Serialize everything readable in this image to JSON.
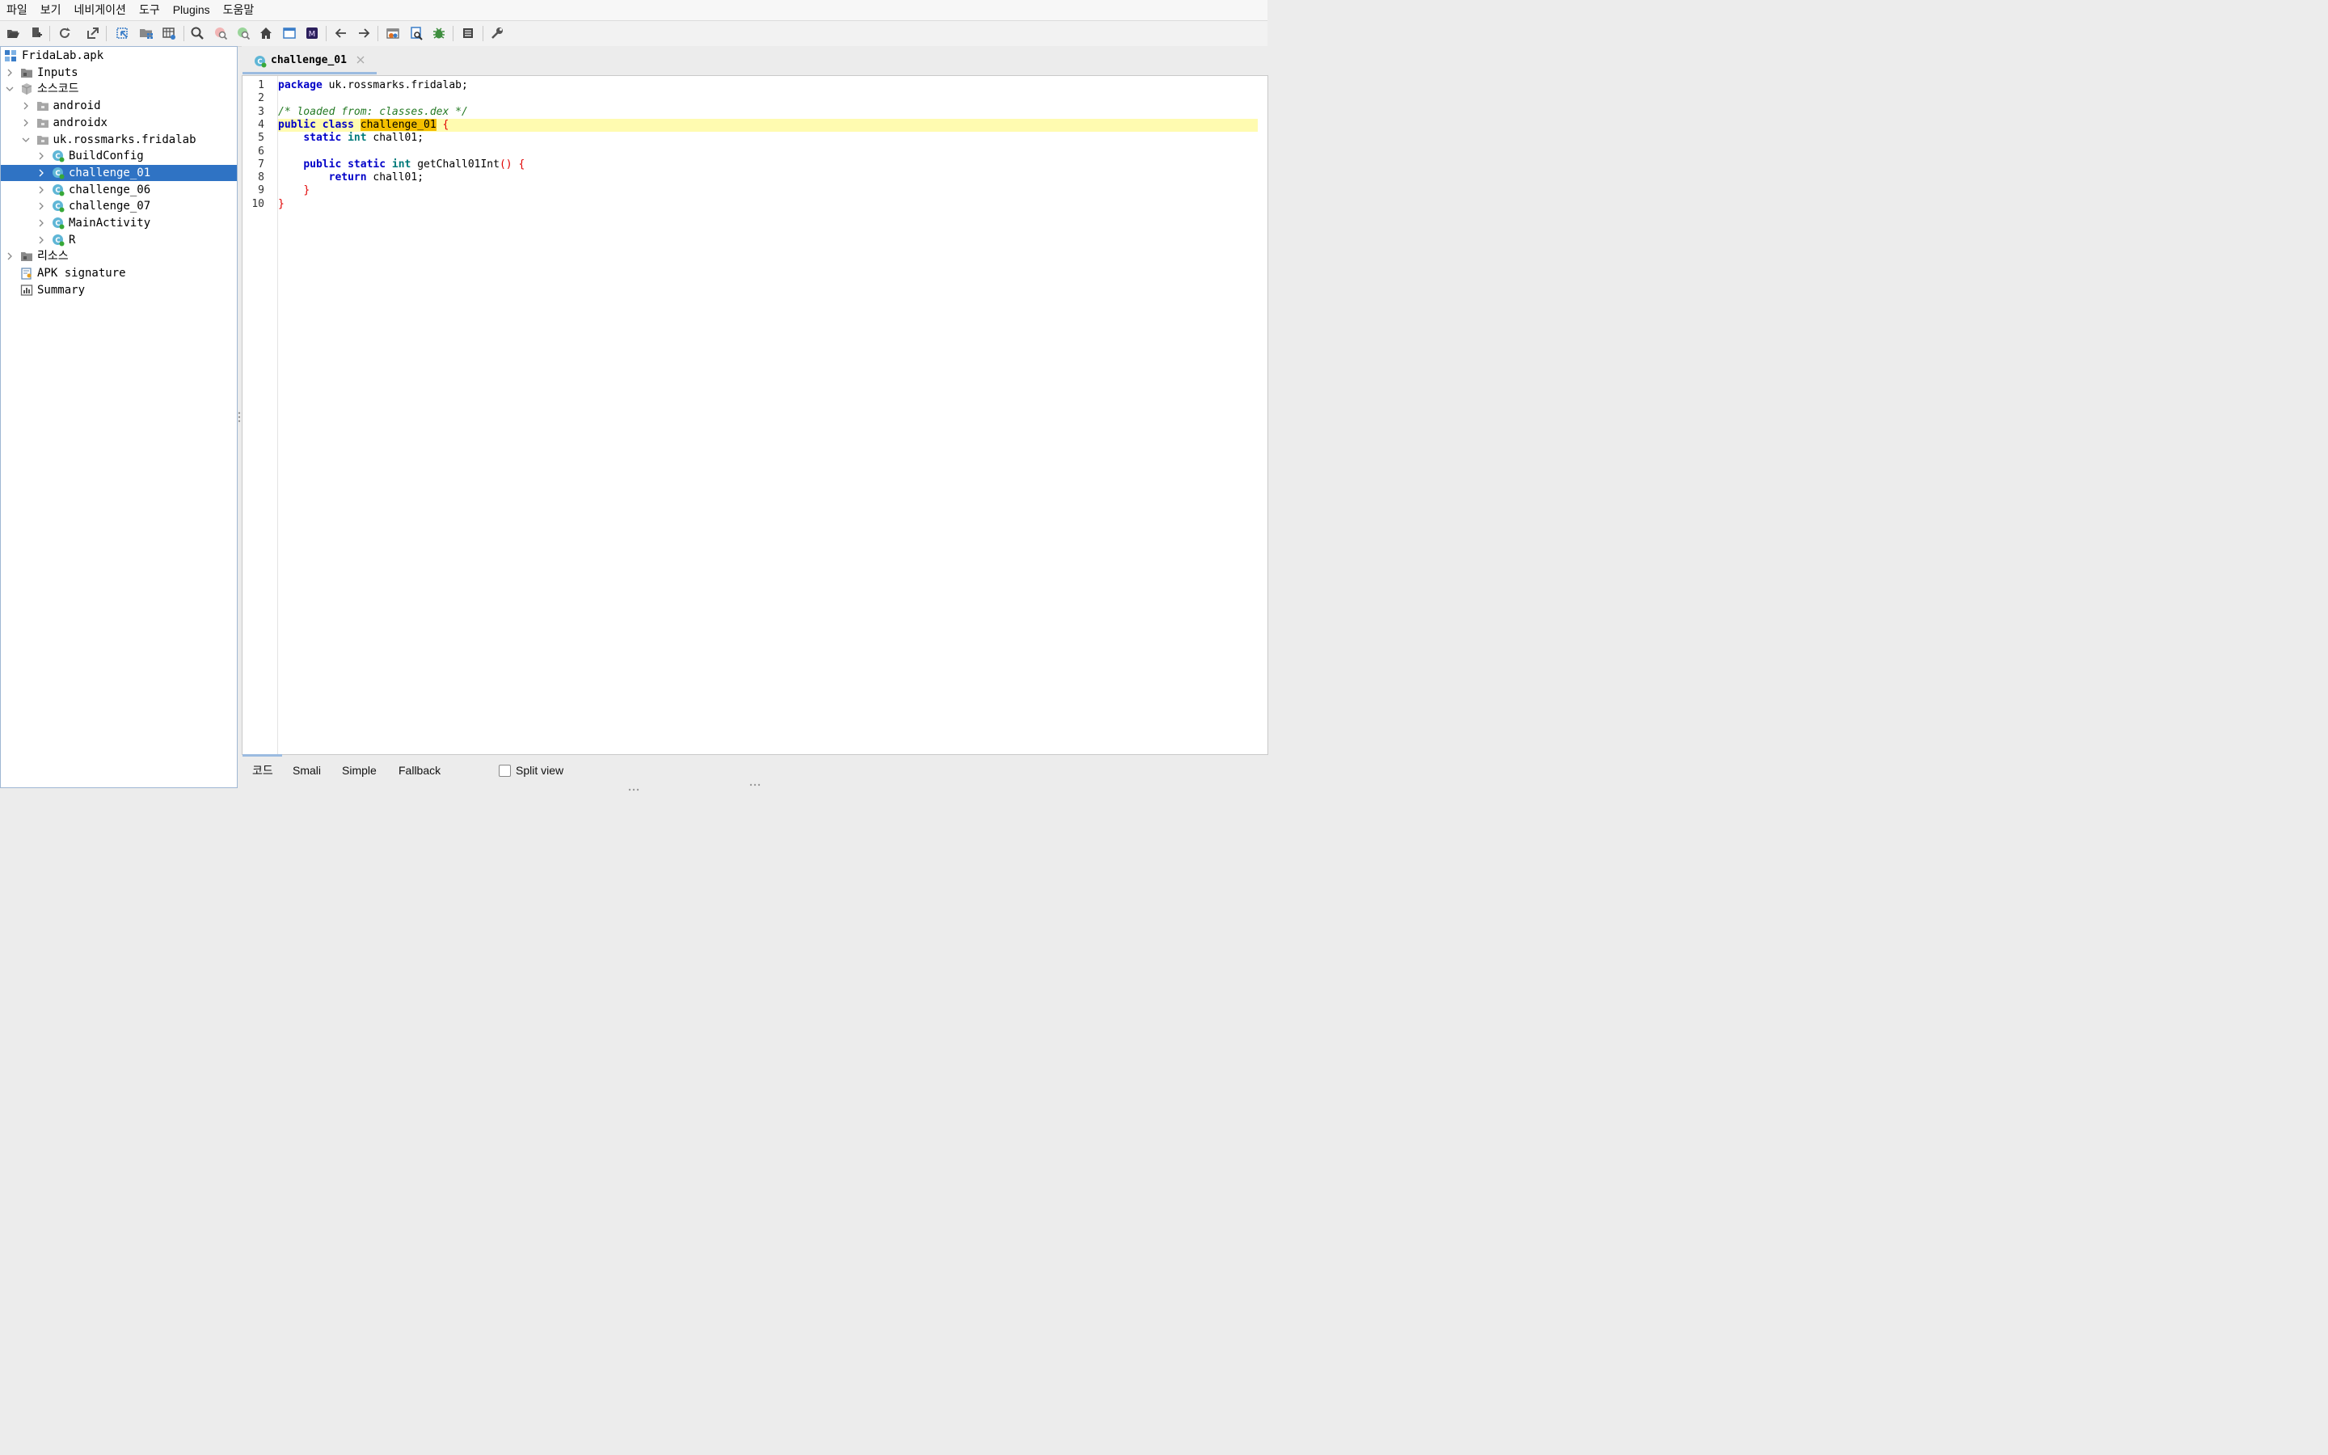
{
  "menu": {
    "items": [
      "파일",
      "보기",
      "네비게이션",
      "도구",
      "Plugins",
      "도움말"
    ]
  },
  "toolbar": {
    "icons": [
      "open-folder-icon",
      "add-files-icon",
      "sync-icon",
      "export-icon",
      "jump-to-icon",
      "class-tree-icon",
      "table-icon",
      "search-icon",
      "search-text-icon",
      "search-usage-icon",
      "home-icon",
      "window-icon",
      "module-icon",
      "back-arrow-icon",
      "forward-arrow-icon",
      "deobfuscation-icon",
      "decompile-icon",
      "debug-bug-icon",
      "log-viewer-icon",
      "preferences-wrench-icon"
    ]
  },
  "tree": {
    "items": [
      {
        "label": "FridaLab.apk",
        "icon": "apk-grid-icon",
        "expander": "none"
      },
      {
        "label": "Inputs",
        "icon": "folder-icon",
        "expander": "collapsed"
      },
      {
        "label": "소스코드",
        "icon": "package-box-icon",
        "expander": "expanded"
      },
      {
        "label": "android",
        "icon": "package-folder-icon",
        "expander": "collapsed"
      },
      {
        "label": "androidx",
        "icon": "package-folder-icon",
        "expander": "collapsed"
      },
      {
        "label": "uk.rossmarks.fridalab",
        "icon": "package-folder-icon",
        "expander": "expanded"
      },
      {
        "label": "BuildConfig",
        "icon": "class-icon",
        "expander": "collapsed"
      },
      {
        "label": "challenge_01",
        "icon": "class-icon",
        "expander": "collapsed"
      },
      {
        "label": "challenge_06",
        "icon": "class-icon",
        "expander": "collapsed"
      },
      {
        "label": "challenge_07",
        "icon": "class-icon",
        "expander": "collapsed"
      },
      {
        "label": "MainActivity",
        "icon": "class-icon",
        "expander": "collapsed"
      },
      {
        "label": "R",
        "icon": "class-icon",
        "expander": "collapsed"
      },
      {
        "label": "리소스",
        "icon": "folder-icon",
        "expander": "collapsed"
      },
      {
        "label": "APK signature",
        "icon": "certificate-icon",
        "expander": "none"
      },
      {
        "label": "Summary",
        "icon": "summary-chart-icon",
        "expander": "none"
      }
    ],
    "selected": "challenge_01"
  },
  "editor": {
    "tab_label": "challenge_01",
    "lines": [
      {
        "num": "1",
        "parts": [
          [
            "kw",
            "package"
          ],
          [
            "",
            "  uk.rossmarks.fridalab;"
          ]
        ]
      },
      {
        "num": "2",
        "parts": []
      },
      {
        "num": "3",
        "parts": [
          [
            "cm",
            "/* loaded from: classes.dex */"
          ]
        ]
      },
      {
        "num": "4",
        "highlight": true,
        "parts": [
          [
            "kw",
            "public class"
          ],
          [
            "",
            " "
          ],
          [
            "mark",
            "challenge_01"
          ],
          [
            "",
            " "
          ],
          [
            "br",
            "{"
          ]
        ]
      },
      {
        "num": "5",
        "parts": [
          [
            "",
            "    "
          ],
          [
            "kw",
            "static"
          ],
          [
            "",
            " "
          ],
          [
            "ty",
            "int"
          ],
          [
            "",
            " chall01;"
          ]
        ]
      },
      {
        "num": "6",
        "parts": []
      },
      {
        "num": "7",
        "parts": [
          [
            "",
            "    "
          ],
          [
            "kw",
            "public static"
          ],
          [
            "",
            " "
          ],
          [
            "ty",
            "int"
          ],
          [
            "",
            " getChall01Int"
          ],
          [
            "br",
            "()"
          ],
          [
            "",
            " "
          ],
          [
            "br",
            "{"
          ]
        ]
      },
      {
        "num": "8",
        "parts": [
          [
            "",
            "        "
          ],
          [
            "kw",
            "return"
          ],
          [
            "",
            " chall01;"
          ]
        ]
      },
      {
        "num": "9",
        "parts": [
          [
            "",
            "    "
          ],
          [
            "br",
            "}"
          ]
        ]
      },
      {
        "num": "10",
        "parts": [
          [
            "br",
            "}"
          ]
        ]
      }
    ]
  },
  "bottom_tabs": {
    "items": [
      "코드",
      "Smali",
      "Simple",
      "Fallback"
    ],
    "split_view_label": "Split view",
    "split_view_checked": false
  }
}
